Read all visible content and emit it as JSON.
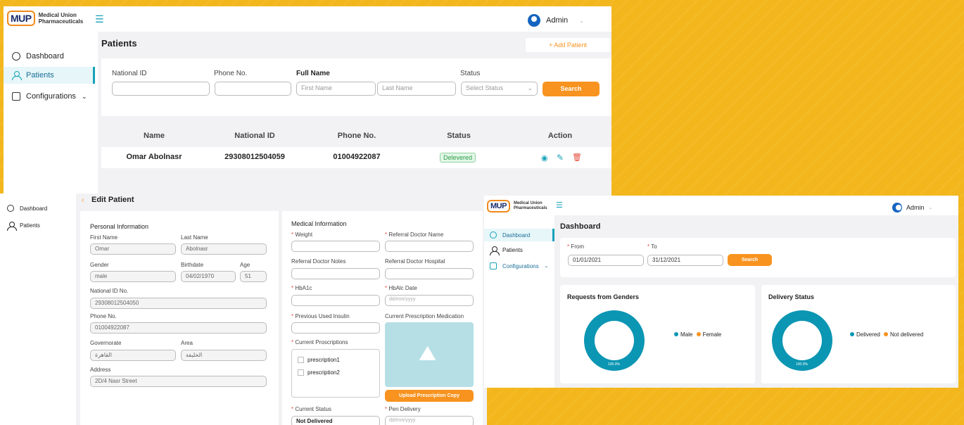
{
  "brand": {
    "mark": "MUP",
    "line1": "Medical Union",
    "line2": "Pharmaceuticals"
  },
  "user": {
    "name": "Admin"
  },
  "top": {
    "page_title": "Patients",
    "add_button": "+ Add Patient",
    "sidebar": [
      "Dashboard",
      "Patients",
      "Configurations"
    ],
    "filters": {
      "national_id_label": "National ID",
      "phone_label": "Phone No.",
      "full_name_label": "Full Name",
      "first_name_placeholder": "First Name",
      "last_name_placeholder": "Last Name",
      "status_label": "Status",
      "status_placeholder": "Select Status",
      "search_button": "Search"
    },
    "table": {
      "headers": [
        "Name",
        "National ID",
        "Phone No.",
        "Status",
        "Action"
      ],
      "rows": [
        {
          "name": "Omar Abolnasr",
          "national_id": "29308012504059",
          "phone": "01004922087",
          "status": "Delevered"
        }
      ]
    }
  },
  "edit": {
    "title": "Edit Patient",
    "sidebar": [
      "Dashboard",
      "Patients"
    ],
    "personal": {
      "section": "Personal Information",
      "first_name_label": "First Name",
      "first_name": "Omar",
      "last_name_label": "Last Name",
      "last_name": "Abolnasr",
      "gender_label": "Gender",
      "gender": "male",
      "birthdate_label": "Birthdate",
      "birthdate": "04/02/1970",
      "age_label": "Age",
      "age": "51",
      "national_id_label": "National ID No.",
      "national_id": "29308012504050",
      "phone_label": "Phone No.",
      "phone": "01004922087",
      "governorate_label": "Governorate",
      "governorate": "القاهرة",
      "area_label": "Area",
      "area": "الخليفة",
      "address_label": "Address",
      "address": "2D/4 Nasr Street"
    },
    "medical": {
      "section": "Medical Information",
      "weight_label": "Weight",
      "ref_doctor_label": "Referral Doctor Name",
      "ref_notes_label": "Referral Doctor Notes",
      "ref_hospital_label": "Referral Doctor Hospital",
      "hba1c_label": "HbA1c",
      "hba1c_date_label": "HbAlc Date",
      "date_placeholder": "dd/mm/yyyy",
      "prev_insulin_label": "Previous Used Insulin",
      "current_med_label": "Current Prescription Medication",
      "current_presc_label": "Current Proscriptions",
      "prescriptions": [
        "prescription1",
        "prescription2"
      ],
      "upload_button": "Upload Prescription Copy",
      "current_status_label": "Current Status",
      "current_status": "Not Delivered",
      "pen_delivery_label": "Pen Delivery"
    }
  },
  "dash": {
    "title": "Dashboard",
    "sidebar": [
      "Dashboard",
      "Patients",
      "Configurations"
    ],
    "from_label": "From",
    "from": "01/01/2021",
    "to_label": "To",
    "to": "31/12/2021",
    "search_button": "Search",
    "genders": {
      "title": "Requests from Genders",
      "legend": [
        "Male",
        "Female"
      ],
      "center": "100.0%"
    },
    "delivery": {
      "title": "Delivery Status",
      "legend": [
        "Delivered",
        "Not delivered"
      ],
      "center": "100.0%"
    },
    "colors": {
      "teal": "#0b96b3",
      "orange": "#f7931e"
    }
  }
}
